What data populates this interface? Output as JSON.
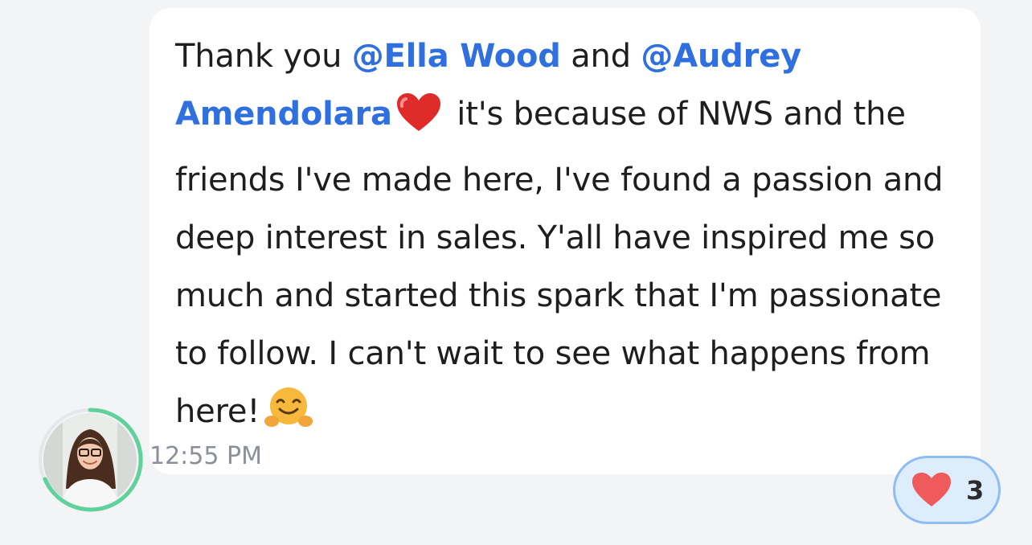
{
  "message": {
    "prefix": "Thank you ",
    "mention_1": "@Ella Wood",
    "middle": " and ",
    "mention_2": "@Audrey Amendolara",
    "text_after_heart": " it's because of NWS and the friends I've made here, I've found a passion and deep interest in sales. Y'all have inspired me so much and started this spark that I'm passionate to follow. I can't wait to see what happens from here!",
    "emoji_heart": "red-heart-emoji",
    "emoji_hug": "hugging-face-emoji"
  },
  "timestamp": "12:55 PM",
  "reaction": {
    "icon": "heart-icon",
    "count": "3"
  },
  "colors": {
    "background": "#f3f4f6",
    "bubble": "#ffffff",
    "mention": "#2f6fe0",
    "text": "#1e1e20",
    "timestamp": "#8a8f98",
    "presence_ring": "#5fd19a",
    "reaction_bg": "#deedfc",
    "reaction_border": "#8dbdf5",
    "heart": "#ef5a5a"
  }
}
